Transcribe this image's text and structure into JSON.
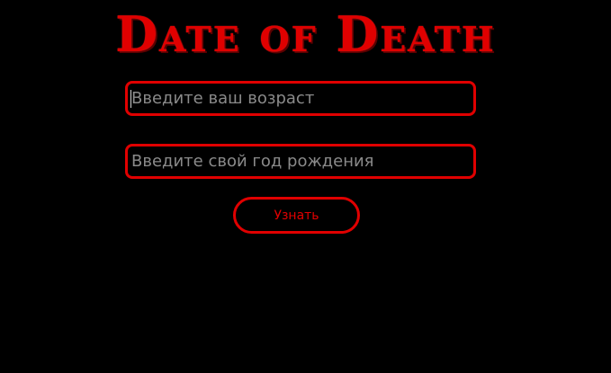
{
  "header": {
    "title": "Date of Death"
  },
  "form": {
    "age_placeholder": "Введите ваш возраст",
    "age_value": "",
    "birth_year_placeholder": "Введите свой год рождения",
    "birth_year_value": "",
    "submit_label": "Узнать"
  },
  "colors": {
    "background": "#000000",
    "accent": "#e00000",
    "placeholder": "#8a8a8a"
  }
}
